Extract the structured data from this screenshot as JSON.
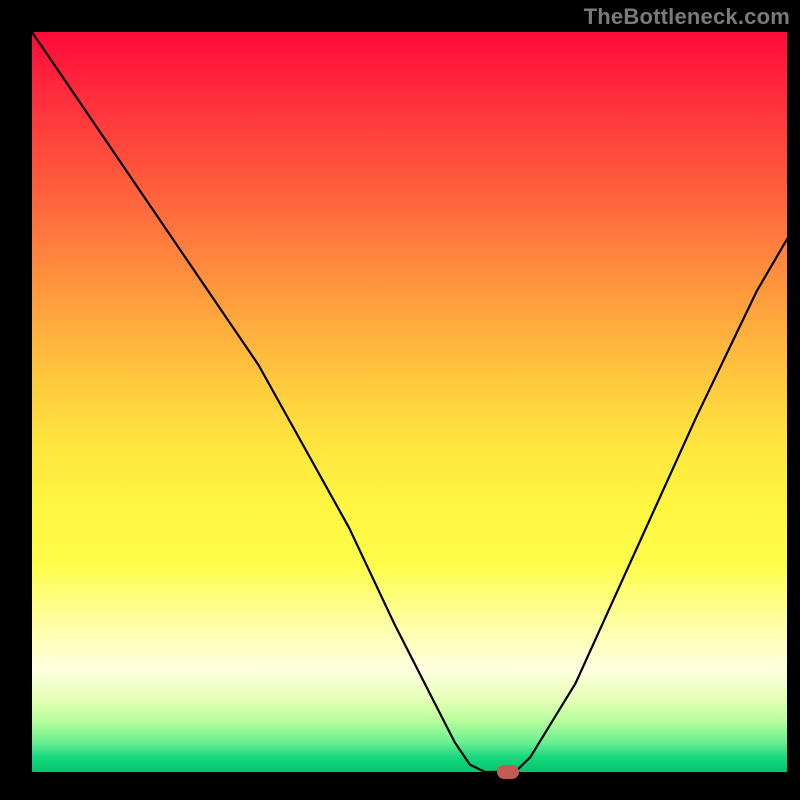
{
  "watermark": "TheBottleneck.com",
  "chart_data": {
    "type": "line",
    "title": "",
    "xlabel": "",
    "ylabel": "",
    "xlim": [
      0,
      100
    ],
    "ylim": [
      0,
      100
    ],
    "grid": false,
    "legend": false,
    "series": [
      {
        "name": "curve",
        "x": [
          0,
          8,
          16,
          24,
          30,
          36,
          42,
          48,
          52,
          56,
          58,
          60,
          64,
          66,
          72,
          80,
          88,
          96,
          100
        ],
        "y": [
          100,
          88,
          76,
          64,
          55,
          44,
          33,
          20,
          12,
          4,
          1,
          0,
          0,
          2,
          12,
          30,
          48,
          65,
          72
        ]
      }
    ],
    "marker": {
      "x": 63,
      "y": 0,
      "color": "#c35a56"
    },
    "gradient_stops": [
      {
        "pos": 0,
        "color": "#ff0a3a"
      },
      {
        "pos": 50,
        "color": "#ffe63f"
      },
      {
        "pos": 85,
        "color": "#ffffe0"
      },
      {
        "pos": 100,
        "color": "#00c46c"
      }
    ]
  }
}
